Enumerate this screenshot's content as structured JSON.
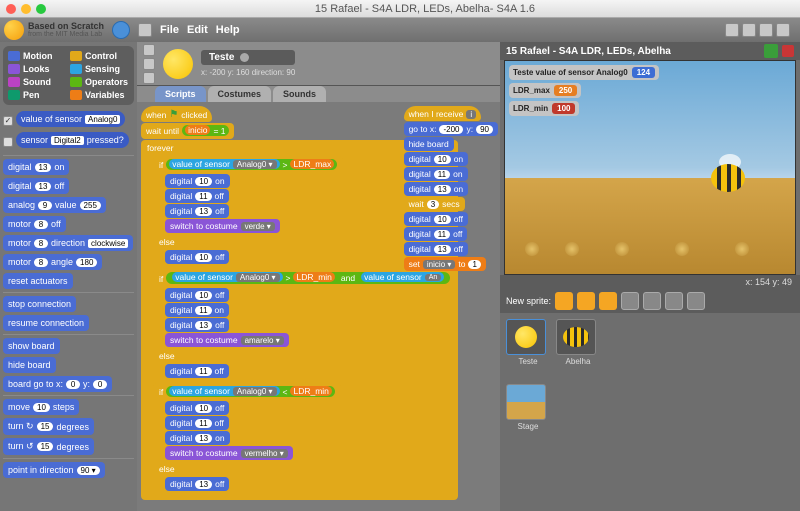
{
  "window": {
    "title": "15 Rafael - S4A LDR, LEDs, Abelha- S4A 1.6"
  },
  "brand": {
    "line1": "Based on Scratch",
    "line2": "from the MIT Media Lab"
  },
  "menu": {
    "file": "File",
    "edit": "Edit",
    "help": "Help"
  },
  "categories": {
    "motion": "Motion",
    "control": "Control",
    "looks": "Looks",
    "sensing": "Sensing",
    "sound": "Sound",
    "operators": "Operators",
    "pen": "Pen",
    "variables": "Variables"
  },
  "palette": {
    "value_of_sensor": "value of sensor",
    "analog0": "Analog0",
    "sensor": "sensor",
    "digital2": "Digital2",
    "pressed": "pressed?",
    "digital": "digital",
    "pin13": "13",
    "on": "on",
    "off": "off",
    "analog": "analog",
    "pin9": "9",
    "value": "value",
    "v255": "255",
    "motor": "motor",
    "pin8": "8",
    "direction": "direction",
    "clockwise": "clockwise",
    "angle": "angle",
    "a180": "180",
    "reset_actuators": "reset actuators",
    "stop_connection": "stop connection",
    "resume_connection": "resume connection",
    "show_board": "show board",
    "hide_board": "hide board",
    "board_goto": "board go to x:",
    "bx": "0",
    "by": "y:",
    "byv": "0",
    "move": "move",
    "steps10": "10",
    "steps": "steps",
    "turn_r": "turn ↻",
    "turn_l": "turn ↺",
    "deg15": "15",
    "degrees": "degrees",
    "point_in_direction": "point in direction",
    "d90": "90 ▾"
  },
  "sprite": {
    "name": "Teste",
    "pos": "x: -200  y: 160   direction: 90",
    "tabs": {
      "scripts": "Scripts",
      "costumes": "Costumes",
      "sounds": "Sounds"
    }
  },
  "scripts": {
    "when_clicked": "when",
    "clicked": "clicked",
    "wait_until": "wait until",
    "inicio": "inicio",
    "eq1": "= 1",
    "forever": "forever",
    "if": "if",
    "else": "else",
    "value_of_sensor": "value of sensor",
    "analog0": "Analog0 ▾",
    "gt": ">",
    "lt": "<",
    "and": "and",
    "ldr_max": "LDR_max",
    "ldr_min": "LDR_min",
    "digital": "digital",
    "p10": "10",
    "p11": "11",
    "p13": "13",
    "on": "on",
    "off": "off",
    "switch_costume": "switch to costume",
    "verde": "verde ▾",
    "amarelo": "amarelo ▾",
    "vermelho": "vermelho ▾",
    "when_receive": "when I receive",
    "msg": "i",
    "goto": "go to x:",
    "gx": "-200",
    "gy": "y:",
    "gyv": "90",
    "hide_board": "hide board",
    "wait": "wait",
    "secs3": "3",
    "secs": "secs",
    "set": "set",
    "inicio_var": "inicio ▾",
    "to": "to",
    "to1": "1"
  },
  "stage": {
    "title": "15 Rafael - S4A LDR, LEDs, Abelha",
    "mon_sensor_label": "Teste value of sensor Analog0",
    "mon_sensor_val": "124",
    "mon_max_label": "LDR_max",
    "mon_max_val": "250",
    "mon_min_label": "LDR_min",
    "mon_min_val": "100",
    "coords": "x: 154   y: 49"
  },
  "sprite_bar": {
    "label": "New sprite:"
  },
  "thumbs": {
    "teste": "Teste",
    "abelha": "Abelha",
    "stage": "Stage"
  }
}
